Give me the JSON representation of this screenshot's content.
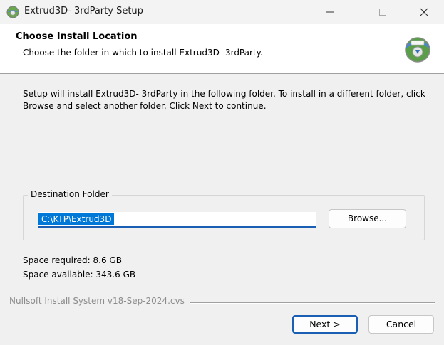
{
  "window": {
    "title": "Extrud3D- 3rdParty Setup",
    "controls": [
      "minimize-icon",
      "maximize-icon",
      "close-icon"
    ]
  },
  "header": {
    "title": "Choose Install Location",
    "subtitle": "Choose the folder in which to install Extrud3D- 3rdParty."
  },
  "body": {
    "description": "Setup will install Extrud3D- 3rdParty in the following folder. To install in a different folder, click Browse and select another folder. Click Next to continue.",
    "destination": {
      "group_label": "Destination Folder",
      "path_value": "C:\\KTP\\Extrud3D",
      "browse_label": "Browse..."
    },
    "space_required": "Space required: 8.6 GB",
    "space_available": "Space available: 343.6 GB"
  },
  "footer": {
    "branding": "Nullsoft Install System v18-Sep-2024.cvs",
    "next_label": "Next >",
    "cancel_label": "Cancel"
  },
  "colors": {
    "accent": "#0078d7",
    "focus_border": "#1a5fb4"
  }
}
